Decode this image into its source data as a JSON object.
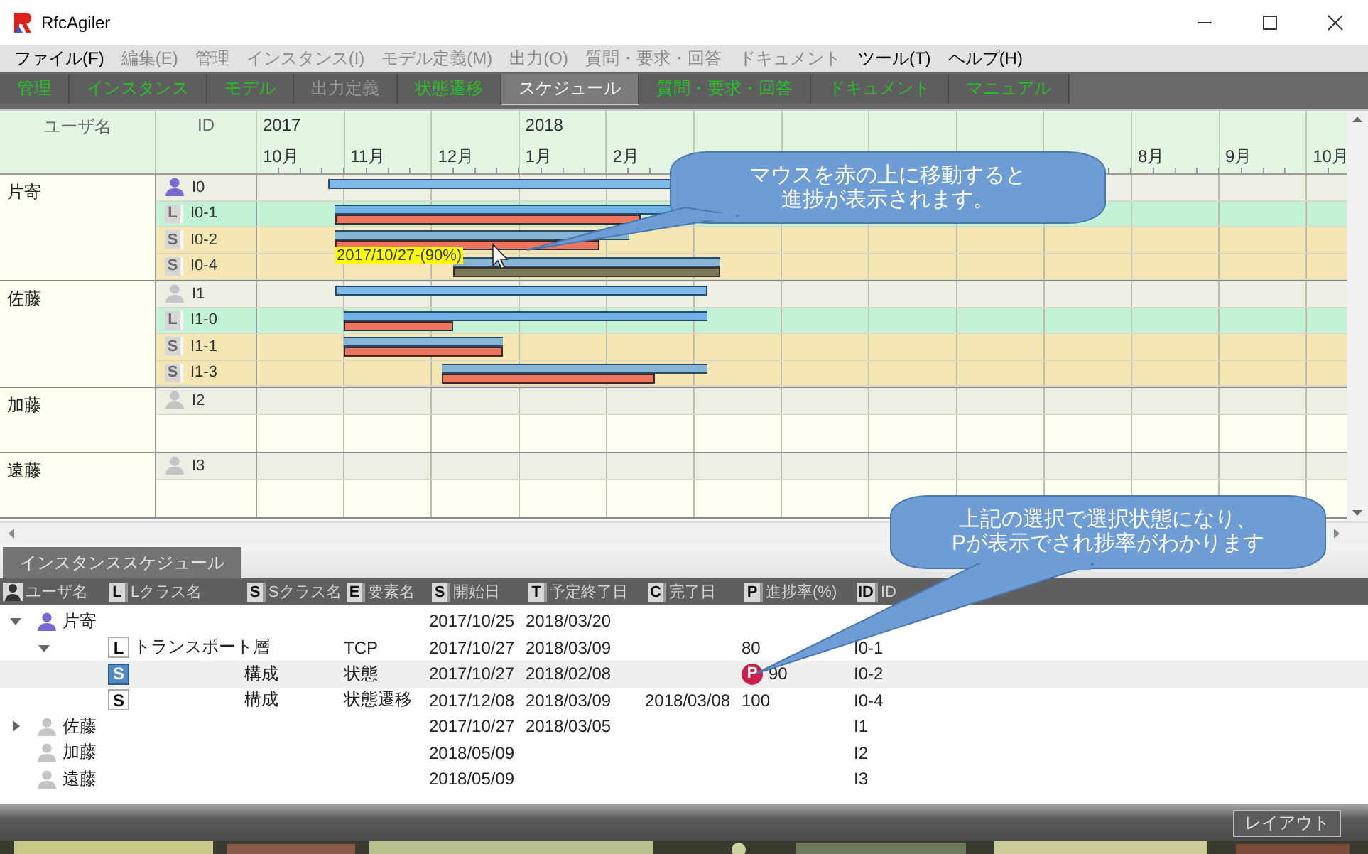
{
  "window": {
    "title": "RfcAgiler"
  },
  "menu": [
    {
      "label": "ファイル(F)",
      "disabled": false
    },
    {
      "label": "編集(E)",
      "disabled": true
    },
    {
      "label": "管理",
      "disabled": true
    },
    {
      "label": "インスタンス(I)",
      "disabled": true
    },
    {
      "label": "モデル定義(M)",
      "disabled": true
    },
    {
      "label": "出力(O)",
      "disabled": true
    },
    {
      "label": "質問・要求・回答",
      "disabled": true
    },
    {
      "label": "ドキュメント",
      "disabled": true
    },
    {
      "label": "ツール(T)",
      "disabled": false
    },
    {
      "label": "ヘルプ(H)",
      "disabled": false
    }
  ],
  "tabs": [
    {
      "label": "管理",
      "selected": false,
      "disabled": false
    },
    {
      "label": "インスタンス",
      "selected": false,
      "disabled": false
    },
    {
      "label": "モデル",
      "selected": false,
      "disabled": false
    },
    {
      "label": "出力定義",
      "selected": false,
      "disabled": true
    },
    {
      "label": "状態遷移",
      "selected": false,
      "disabled": false
    },
    {
      "label": "スケジュール",
      "selected": true,
      "disabled": false
    },
    {
      "label": "質問・要求・回答",
      "selected": false,
      "disabled": false
    },
    {
      "label": "ドキュメント",
      "selected": false,
      "disabled": false
    },
    {
      "label": "マニュアル",
      "selected": false,
      "disabled": false
    }
  ],
  "gantt": {
    "columns": [
      "ユーザ名",
      "ID"
    ],
    "months": {
      "start": [
        {
          "year": "2017",
          "label": "10月"
        },
        {
          "label": "11月"
        },
        {
          "label": "12月"
        },
        {
          "year": "2018",
          "label": "1月"
        },
        {
          "label": "2月"
        }
      ],
      "end": [
        {
          "label": "8月"
        },
        {
          "label": "9月"
        },
        {
          "label": "10月"
        }
      ]
    },
    "users": [
      {
        "name": "片寄",
        "rows": [
          {
            "kind": "user",
            "id": "I0",
            "color": "#7b68d6"
          },
          {
            "kind": "lclass",
            "badge": "L",
            "id": "I0-1",
            "level": 0.8,
            "done": false
          },
          {
            "kind": "sclass",
            "badge": "S",
            "id": "I0-2",
            "level": 0.9,
            "done": false
          },
          {
            "kind": "sclass",
            "badge": "S",
            "id": "I0-4",
            "level": 1,
            "done": true
          }
        ]
      },
      {
        "name": "佐藤",
        "rows": [
          {
            "kind": "user",
            "id": "I1",
            "color": "#c4c4c4"
          },
          {
            "kind": "lclass",
            "badge": "L",
            "id": "I1-0",
            "level": 0.3,
            "done": false
          },
          {
            "kind": "sclass",
            "badge": "S",
            "id": "I1-1",
            "level": 1,
            "done": false
          },
          {
            "kind": "sclass",
            "badge": "S",
            "id": "I1-3",
            "level": 0.8,
            "done": false
          }
        ]
      },
      {
        "name": "加藤",
        "rows": [
          {
            "kind": "user",
            "id": "I2",
            "color": "#c4c4c4"
          }
        ]
      },
      {
        "name": "遠藤",
        "rows": [
          {
            "kind": "user",
            "id": "I3",
            "color": "#c4c4c4"
          }
        ]
      }
    ]
  },
  "tooltip": {
    "text": "2017/10/27-(90%)"
  },
  "callouts": [
    {
      "lines": [
        "マウスを赤の上に移動すると",
        "進捗が表示されます。"
      ]
    },
    {
      "lines": [
        "上記の選択で選択状態になり、",
        "Pが表示でされ捗率がわかります"
      ]
    }
  ],
  "panel": {
    "tab": "インスタンススケジュール",
    "columns": [
      {
        "label": "ユーザ名"
      },
      {
        "badge": "L",
        "label": "Lクラス名"
      },
      {
        "badge": "S",
        "label": "Sクラス名"
      },
      {
        "badge": "E",
        "label": "要素名"
      },
      {
        "badge": "S",
        "label": "開始日"
      },
      {
        "badge": "T",
        "label": "予定終了日"
      },
      {
        "badge": "C",
        "label": "完了日"
      },
      {
        "badge": "P",
        "label": "進捗率(%)"
      },
      {
        "badge": "ID",
        "label": "ID"
      }
    ],
    "rows": [
      {
        "kind": "user",
        "name": "片寄",
        "color": "#7b68d6",
        "expanded": true,
        "selected": false,
        "start": "2017/10/25",
        "end": "2018/03/20",
        "children": [
          {
            "kind": "lclass",
            "badge": "L",
            "name": "トランスポート層",
            "expanded": true,
            "selected": false,
            "element": "TCP",
            "start": "2017/10/27",
            "end": "2018/03/09",
            "progress": "80",
            "id": "I0-1",
            "children": [
              {
                "kind": "sclass",
                "badge": "S",
                "sclass": "構成",
                "element": "状態",
                "selected": true,
                "start": "2017/10/27",
                "end": "2018/02/08",
                "progress_badge": "P",
                "progress": "90",
                "id": "I0-2"
              },
              {
                "kind": "sclass",
                "badge": "S",
                "sclass": "構成",
                "element": "状態遷移",
                "selected": false,
                "start": "2017/12/08",
                "end": "2018/03/09",
                "completed": "2018/03/08",
                "progress": "100",
                "id": "I0-4"
              }
            ]
          }
        ]
      },
      {
        "kind": "user",
        "name": "佐藤",
        "color": "#c4c4c4",
        "expanded": false,
        "selected": false,
        "start": "2017/10/27",
        "end": "2018/03/05",
        "id": "I1"
      },
      {
        "kind": "user",
        "name": "加藤",
        "color": "#c4c4c4",
        "selected": false,
        "start": "2018/05/09",
        "id": "I2"
      },
      {
        "kind": "user",
        "name": "遠藤",
        "color": "#c4c4c4",
        "selected": false,
        "start": "2018/05/09",
        "id": "I3"
      }
    ]
  },
  "layout_button": "レイアウト"
}
